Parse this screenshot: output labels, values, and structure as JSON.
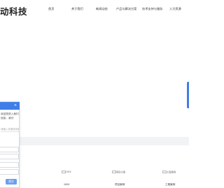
{
  "header": {
    "logo_text": "动科技",
    "nav": [
      "首页",
      "关于我们",
      "新闻动态",
      "产品与解决方案",
      "技术支持与服务",
      "人力资源"
    ]
  },
  "products": [
    {
      "alt": "100X",
      "caption": "100X"
    },
    {
      "alt": "项目方案",
      "caption": "项目案例"
    },
    {
      "alt": "工程案例",
      "caption": "工程案例"
    }
  ],
  "chat": {
    "close_icon": "close-icon",
    "message_lines": [
      "欢迎您进入我们",
      "信息，我们"
    ],
    "placeholder": "请输入你要咨询的内容",
    "submit_label": "提交"
  },
  "colors": {
    "accent": "#3f7ee8",
    "band": "#f2f3f5"
  }
}
